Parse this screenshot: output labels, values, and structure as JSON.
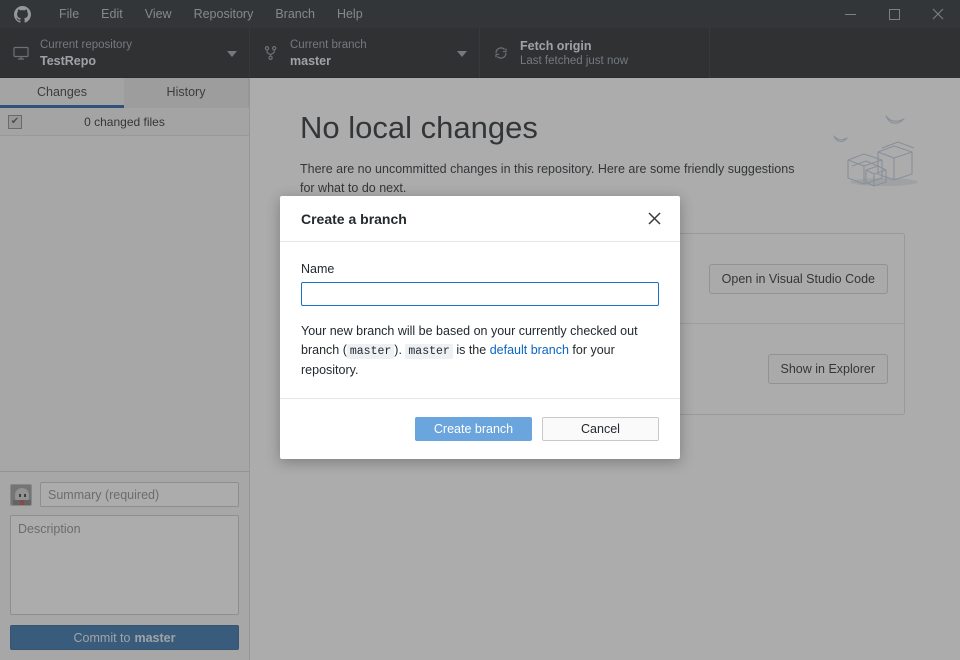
{
  "app": {
    "logo_icon": "github-mark-icon",
    "menu": [
      {
        "label": "File"
      },
      {
        "label": "Edit"
      },
      {
        "label": "View"
      },
      {
        "label": "Repository"
      },
      {
        "label": "Branch"
      },
      {
        "label": "Help"
      }
    ],
    "window_controls": {
      "minimize": "—",
      "maximize": "□",
      "close": "✕"
    }
  },
  "toolbar": {
    "repository": {
      "icon": "desktop-screen-icon",
      "label": "Current repository",
      "value": "TestRepo",
      "caret": "▾"
    },
    "branch": {
      "icon": "git-branch-icon",
      "label": "Current branch",
      "value": "master",
      "caret": "▾"
    },
    "fetch": {
      "icon": "sync-refresh-icon",
      "label": "Fetch origin",
      "value": "Last fetched just now"
    }
  },
  "sidebar": {
    "tabs": [
      {
        "label": "Changes",
        "active": true
      },
      {
        "label": "History",
        "active": false
      }
    ],
    "changed_files": {
      "checkbox_glyph": "✔",
      "label": "0 changed files"
    },
    "commit": {
      "avatar_icon": "user-avatar-icon",
      "summary_placeholder": "Summary (required)",
      "description_placeholder": "Description",
      "button_prefix": "Commit to",
      "button_branch": "master"
    }
  },
  "main": {
    "heading": "No local changes",
    "description": "There are no uncommitted changes in this repository. Here are some friendly suggestions for what to do next.",
    "illustration_icon": "boxes-and-birds-illustration",
    "suggestions": [
      {
        "button_label": "Open in Visual Studio Code"
      },
      {
        "button_label": "Show in Explorer"
      }
    ]
  },
  "dialog": {
    "title": "Create a branch",
    "close_icon": "close-x-icon",
    "name_label": "Name",
    "name_value": "",
    "name_placeholder": "",
    "description": {
      "part1": "Your new branch will be based on your currently checked out branch (",
      "code1": "master",
      "part2": ").",
      "code2": "master",
      "part3": "is the",
      "link": "default branch",
      "part4": "for your repository."
    },
    "primary_button": "Create branch",
    "secondary_button": "Cancel"
  },
  "colors": {
    "titlebar_bg": "#24292e",
    "toolbar_bg": "#1c2024",
    "accent_blue": "#1f5a9e",
    "primary_button": "#6aa5dd",
    "commit_button": "#2f6ca8",
    "link": "#0a66c2",
    "focus_border": "#1673c8"
  }
}
